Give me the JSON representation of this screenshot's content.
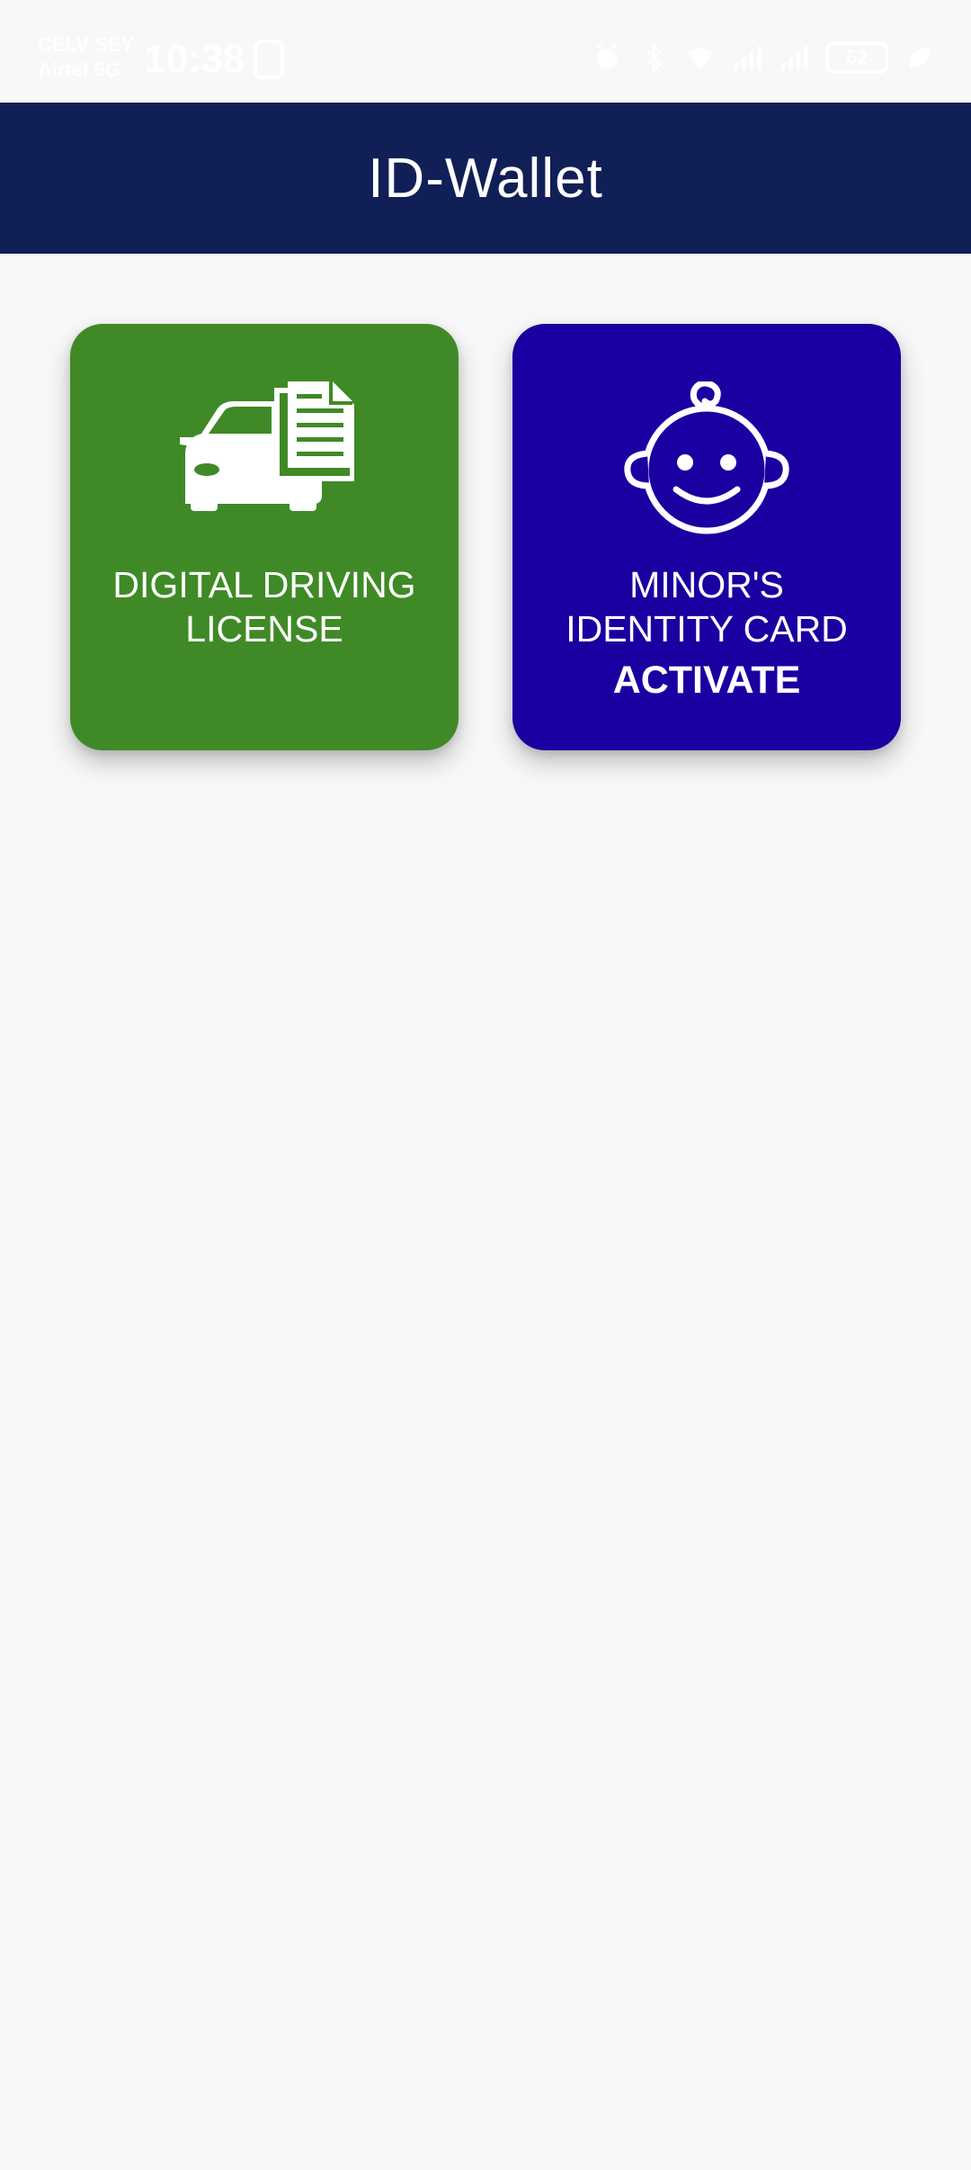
{
  "status_bar": {
    "carrier_line1": "CELV SEY",
    "carrier_line2": "Airtel 5G",
    "time": "10:38",
    "battery": "62",
    "icons": [
      "alarm-icon",
      "bluetooth-icon",
      "wifi-icon",
      "signal-icon",
      "signal-icon",
      "battery-icon",
      "leaf-icon"
    ]
  },
  "app_bar": {
    "title": "ID-Wallet",
    "background": "#111f57"
  },
  "cards": [
    {
      "icon": "car-documents-icon",
      "label_line1": "DIGITAL DRIVING",
      "label_line2": "LICENSE",
      "background": "#3f8a26"
    },
    {
      "icon": "baby-face-icon",
      "label_line1": "MINOR'S",
      "label_line2": "IDENTITY CARD",
      "action": "ACTIVATE",
      "background": "#1a00a0"
    }
  ]
}
